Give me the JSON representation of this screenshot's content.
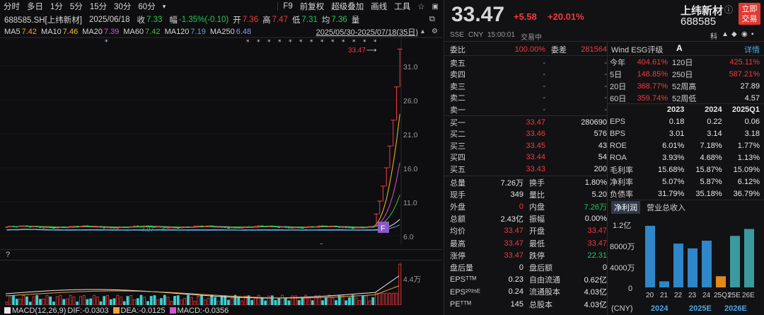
{
  "toolbar": {
    "periods": [
      "分时",
      "多日",
      "1分",
      "5分",
      "15分",
      "30分",
      "60分"
    ],
    "tools": [
      "F9",
      "前复权",
      "超级叠加",
      "画线",
      "工具"
    ],
    "tools_icons": [
      "star-icon",
      "app-icon"
    ]
  },
  "info": {
    "code": "688585.SH[上纬新材]",
    "date": "2025/06/18",
    "close_label": "收",
    "close": "7.33",
    "chg_label": "幅",
    "chg": "-1.35%(-0.10)",
    "open_label": "开",
    "open": "7.36",
    "high_label": "高",
    "high": "7.47",
    "low_label": "低",
    "low": "7.31",
    "avg_label": "均",
    "avg": "7.36",
    "vol_label": "量"
  },
  "ma": {
    "ma5_label": "MA5",
    "ma5": "7.42",
    "ma10_label": "MA10",
    "ma10": "7.46",
    "ma20_label": "MA20",
    "ma20": "7.39",
    "ma60_label": "MA60",
    "ma60": "7.42",
    "ma120_label": "MA120",
    "ma120": "7.19",
    "ma250_label": "MA250",
    "ma250": "6.48",
    "range": "2025/05/30-2025/07/18(35日)"
  },
  "chart": {
    "price_ticks": [
      "31.0",
      "26.0",
      "21.0",
      "16.0",
      "11.0",
      "6.0"
    ],
    "high_label": "33.47",
    "low_label": "7.07",
    "f_badge": "F",
    "r_mark": "R",
    "vol_tick": "4.4万",
    "help": "?",
    "macd_label": "MACD(12,26,9)",
    "dif_label": "DIF:",
    "dif": "-0.0303",
    "dea_label": "DEA:",
    "dea": "-0.0125",
    "macd_v_label": "MACD:",
    "macd_v": "-0.0356"
  },
  "colors": {
    "up": "#f0393e",
    "down": "#26c75a",
    "ma5": "#e8e8e8",
    "ma10": "#f2c025",
    "ma20": "#d155d1",
    "ma60": "#3fbf3f",
    "ma120": "#4aa8e8",
    "ma250": "#7aa0ff"
  },
  "quote": {
    "price": "33.47",
    "change": "+5.58",
    "pct": "+20.01%",
    "name": "上纬新材",
    "code": "688585",
    "trade_btn": [
      "立即",
      "交易"
    ],
    "market": "SSE",
    "currency": "CNY",
    "time": "15:00:01",
    "status": "交易中",
    "icons_label": "科"
  },
  "orderbook": {
    "wb_label": "委比",
    "wb": "100.00%",
    "wc_label": "委差",
    "wc": "281564",
    "asks": [
      {
        "label": "卖五",
        "price": "-",
        "vol": "-"
      },
      {
        "label": "卖四",
        "price": "-",
        "vol": "-"
      },
      {
        "label": "卖三",
        "price": "-",
        "vol": "-"
      },
      {
        "label": "卖二",
        "price": "-",
        "vol": "-"
      },
      {
        "label": "卖一",
        "price": "-",
        "vol": "-"
      }
    ],
    "bids": [
      {
        "label": "买一",
        "price": "33.47",
        "vol": "280690"
      },
      {
        "label": "买二",
        "price": "33.46",
        "vol": "576"
      },
      {
        "label": "买三",
        "price": "33.45",
        "vol": "43"
      },
      {
        "label": "买四",
        "price": "33.44",
        "vol": "54"
      },
      {
        "label": "买五",
        "price": "33.43",
        "vol": "200"
      }
    ]
  },
  "stats": [
    {
      "l1": "总量",
      "a": "7.26万",
      "ac": "white",
      "l2": "换手",
      "b": "1.80%",
      "bc": "white"
    },
    {
      "l1": "现手",
      "a": "349",
      "ac": "white",
      "l2": "量比",
      "b": "5.20",
      "bc": "white"
    },
    {
      "l1": "外盘",
      "a": "0",
      "ac": "red",
      "l2": "内盘",
      "b": "7.26万",
      "bc": "green"
    },
    {
      "l1": "总额",
      "a": "2.43亿",
      "ac": "white",
      "l2": "振幅",
      "b": "0.00%",
      "bc": "white"
    },
    {
      "l1": "均价",
      "a": "33.47",
      "ac": "red",
      "l2": "开盘",
      "b": "33.47",
      "bc": "red"
    },
    {
      "l1": "最高",
      "a": "33.47",
      "ac": "red",
      "l2": "最低",
      "b": "33.47",
      "bc": "red"
    },
    {
      "l1": "涨停",
      "a": "33.47",
      "ac": "red",
      "l2": "跌停",
      "b": "22.31",
      "bc": "green"
    },
    {
      "l1": "盘后量",
      "a": "0",
      "ac": "white",
      "l2": "盘后额",
      "b": "0",
      "bc": "white"
    },
    {
      "l1": "EPSᵀᵀᴹ",
      "a": "0.23",
      "ac": "white",
      "l2": "自由流通",
      "b": "0.62亿",
      "bc": "white"
    },
    {
      "l1": "EPS²⁰²⁵ᴱ",
      "a": "0.24",
      "ac": "white",
      "l2": "流通股本",
      "b": "4.03亿",
      "bc": "white"
    },
    {
      "l1": "PEᵀᵀᴹ",
      "a": "145",
      "ac": "white",
      "l2": "总股本",
      "b": "4.03亿",
      "bc": "white"
    }
  ],
  "wind": {
    "label": "Wind ESG评级",
    "rating": "A",
    "detail": "详情",
    "rows": [
      {
        "l1": "今年",
        "a": "404.61%",
        "l2": "120日",
        "b": "425.11%",
        "bc": "red"
      },
      {
        "l1": "5日",
        "a": "148.85%",
        "l2": "250日",
        "b": "587.21%",
        "bc": "red"
      },
      {
        "l1": "20日",
        "a": "368.77%",
        "l2": "52周高",
        "b": "27.89",
        "bc": "white"
      },
      {
        "l1": "60日",
        "a": "359.74%",
        "l2": "52周低",
        "b": "4.57",
        "bc": "white"
      }
    ]
  },
  "fin": {
    "years": [
      "2023",
      "2024",
      "2025Q1"
    ],
    "rows": [
      {
        "l": "EPS",
        "v": [
          "0.18",
          "0.22",
          "0.06"
        ]
      },
      {
        "l": "BPS",
        "v": [
          "3.01",
          "3.14",
          "3.18"
        ]
      },
      {
        "l": "ROE",
        "v": [
          "6.01%",
          "7.18%",
          "1.77%"
        ]
      },
      {
        "l": "ROA",
        "v": [
          "3.93%",
          "4.68%",
          "1.13%"
        ]
      },
      {
        "l": "毛利率",
        "v": [
          "15.68%",
          "15.87%",
          "15.09%"
        ]
      },
      {
        "l": "净利率",
        "v": [
          "5.07%",
          "5.87%",
          "6.12%"
        ]
      },
      {
        "l": "负债率",
        "v": [
          "31.79%",
          "35.18%",
          "36.79%"
        ]
      }
    ]
  },
  "profit_chart": {
    "tabs": [
      "净利润",
      "营业总收入"
    ],
    "y_ticks": [
      "1.2亿",
      "8000万",
      "4000万",
      "0"
    ],
    "categories": [
      "20",
      "21",
      "22",
      "23",
      "24",
      "25Q1",
      "25E",
      "26E"
    ],
    "values": [
      11600,
      1150,
      8250,
      7350,
      8800,
      2100,
      9700,
      11000
    ],
    "colors": [
      "#2f86c8",
      "#2f86c8",
      "#2f86c8",
      "#2f86c8",
      "#2f86c8",
      "#e08a1e",
      "#3a9aa0",
      "#3a9aa0"
    ],
    "footer": [
      "(CNY)",
      "2024",
      "2025E",
      "2026E"
    ]
  }
}
